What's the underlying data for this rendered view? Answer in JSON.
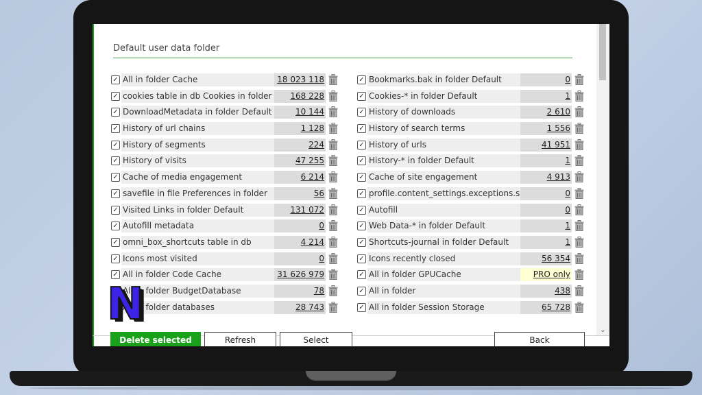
{
  "title": "Default user data folder",
  "colors": {
    "accent": "#1aa11a",
    "pro_highlight": "#fffed2",
    "background": "#c6d3e8"
  },
  "left_items": [
    {
      "label": "All in folder Cache",
      "value": "18 023 118"
    },
    {
      "label": "cookies table in db Cookies in folder",
      "value": "168 228"
    },
    {
      "label": "DownloadMetadata in folder Default",
      "value": "10 144"
    },
    {
      "label": "History of url chains",
      "value": "1 128"
    },
    {
      "label": "History of segments",
      "value": "224"
    },
    {
      "label": "History of visits",
      "value": "47 255"
    },
    {
      "label": "Cache of media engagement",
      "value": "6 214"
    },
    {
      "label": "savefile in file Preferences in folder",
      "value": "56"
    },
    {
      "label": "Visited Links in folder Default",
      "value": "131 072"
    },
    {
      "label": "Autofill metadata",
      "value": "0"
    },
    {
      "label": "omni_box_shortcuts table in db",
      "value": "4 214"
    },
    {
      "label": "Icons most visited",
      "value": "0"
    },
    {
      "label": "All in folder Code Cache",
      "value": "31 626 979"
    },
    {
      "label": "All in folder BudgetDatabase",
      "value": "78"
    },
    {
      "label": "All in folder databases",
      "value": "28 743"
    }
  ],
  "right_items": [
    {
      "label": "Bookmarks.bak in folder Default",
      "value": "0"
    },
    {
      "label": "Cookies-* in folder Default",
      "value": "1"
    },
    {
      "label": "History of downloads",
      "value": "2 610"
    },
    {
      "label": "History of search terms",
      "value": "1 556"
    },
    {
      "label": "History of urls",
      "value": "41 951"
    },
    {
      "label": "History-* in folder Default",
      "value": "1"
    },
    {
      "label": "Cache of site engagement",
      "value": "4 913"
    },
    {
      "label": "profile.content_settings.exceptions.s",
      "value": "0"
    },
    {
      "label": "Autofill",
      "value": "0"
    },
    {
      "label": "Web Data-* in folder Default",
      "value": "1"
    },
    {
      "label": "Shortcuts-journal in folder Default",
      "value": "1"
    },
    {
      "label": "Icons recently closed",
      "value": "56 354"
    },
    {
      "label": "All in folder GPUCache",
      "value": "PRO only"
    },
    {
      "label": "All in folder",
      "value": "438"
    },
    {
      "label": "All in folder Session Storage",
      "value": "65 728"
    }
  ],
  "buttons": {
    "delete": "Delete selected",
    "refresh": "Refresh",
    "select": "Select",
    "back": "Back"
  },
  "icons": {
    "trash": "trash-icon",
    "checkbox": "checkmark-icon",
    "logo": "N-logo-icon"
  },
  "watermark_letter": "N"
}
